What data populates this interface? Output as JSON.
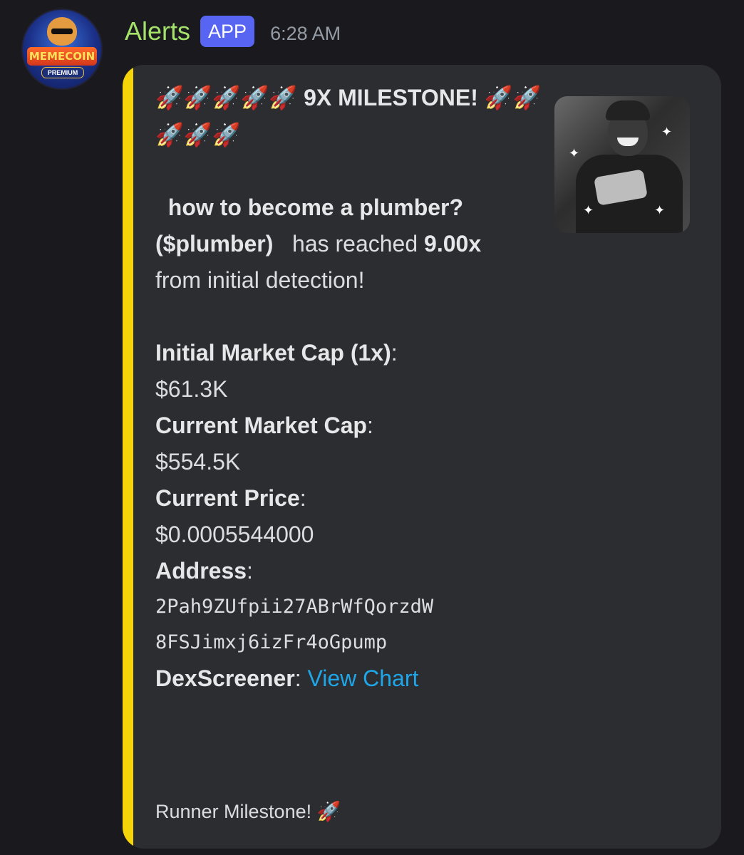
{
  "author": {
    "name": "Alerts",
    "badge": "APP",
    "avatar_text": "MEMECOIN",
    "avatar_subtext": "PREMIUM"
  },
  "timestamp": "6:28 AM",
  "embed": {
    "accent_color": "#f5d40a",
    "title_rockets_before": "🚀🚀🚀🚀🚀",
    "title_milestone": "9X MILESTONE!",
    "title_rockets_after": "🚀🚀🚀🚀🚀",
    "token_name": "how to become a plumber? ($plumber)",
    "text_has_reached": "has reached",
    "multiplier": "9.00x",
    "text_detection": "from initial detection!",
    "fields": {
      "initial_mc_label": "Initial Market Cap (1x)",
      "initial_mc_value": "$61.3K",
      "current_mc_label": "Current Market Cap",
      "current_mc_value": "$554.5K",
      "current_price_label": "Current Price",
      "current_price_value": "$0.0005544000",
      "address_label": "Address",
      "address_line1": "2Pah9ZUfpii27ABrWfQorzdW",
      "address_line2": "8FSJimxj6izFr4oGpump",
      "dex_label": "DexScreener",
      "dex_link": "View Chart"
    },
    "footer": "Runner Milestone! 🚀"
  },
  "colors": {
    "author": "#a4e26b",
    "badge": "#5865f2",
    "link": "#1fa6e8",
    "background": "#1a1a1e",
    "embed_bg": "#2b2d31"
  },
  "icons": {
    "thumbnail": "man-holding-cash-image",
    "rocket": "rocket-emoji"
  }
}
